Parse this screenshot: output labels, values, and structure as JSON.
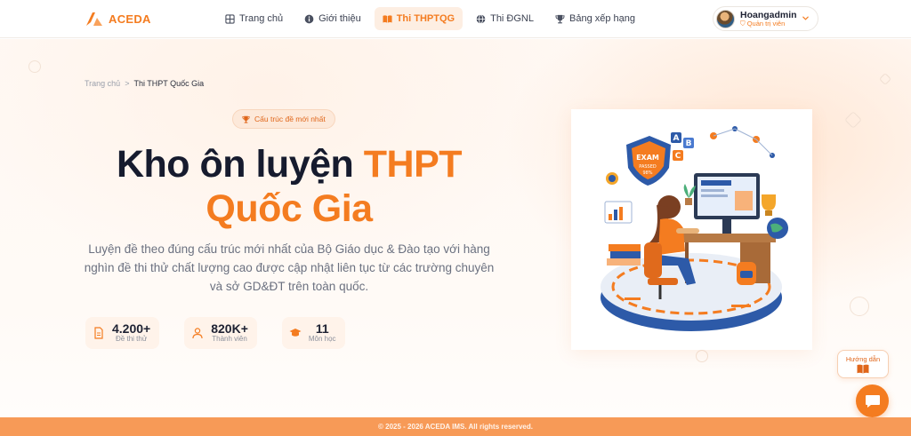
{
  "brand": {
    "name": "ACEDA",
    "color": "#f47c20"
  },
  "nav": {
    "items": [
      {
        "label": "Trang chủ",
        "icon": "grid-icon",
        "active": false
      },
      {
        "label": "Giới thiệu",
        "icon": "info-icon",
        "active": false
      },
      {
        "label": "Thi THPTQG",
        "icon": "book-open-icon",
        "active": true
      },
      {
        "label": "Thi ĐGNL",
        "icon": "globe-icon",
        "active": false
      },
      {
        "label": "Bảng xếp hạng",
        "icon": "trophy-icon",
        "active": false
      }
    ]
  },
  "user": {
    "name": "Hoangadmin",
    "role": "Quản trị viên"
  },
  "breadcrumb": {
    "home": "Trang chủ",
    "separator": ">",
    "current": "Thi THPT Quốc Gia"
  },
  "hero": {
    "badge": "Cấu trúc đề mới nhất",
    "title_main": "Kho ôn luyện",
    "title_accent": "THPT",
    "title_line2": "Quốc Gia",
    "description": "Luyện đề theo đúng cấu trúc mới nhất của Bộ Giáo dục & Đào tạo với hàng nghìn đề thi thử chất lượng cao được cập nhật liên tục từ các trường chuyên và sở GD&ĐT trên toàn quốc."
  },
  "stats": [
    {
      "value": "4.200+",
      "label": "Đề thi thử",
      "icon": "document-icon"
    },
    {
      "value": "820K+",
      "label": "Thành viên",
      "icon": "user-icon"
    },
    {
      "value": "11",
      "label": "Môn học",
      "icon": "graduation-cap-icon"
    }
  ],
  "illustration": {
    "exam_badge": "EXAM",
    "passed_text": "PASSED",
    "percent": "98%",
    "letters": [
      "A",
      "B",
      "C"
    ]
  },
  "widgets": {
    "guide_label": "Hướng dẫn",
    "guide_icon": "book-icon",
    "chat_icon": "chat-icon"
  },
  "footer": {
    "copyright": "© 2025 - 2026 ACEDA IMS. All rights reserved."
  },
  "colors": {
    "accent": "#f47c20",
    "footer": "#f79a57",
    "text_dark": "#161b2e"
  }
}
